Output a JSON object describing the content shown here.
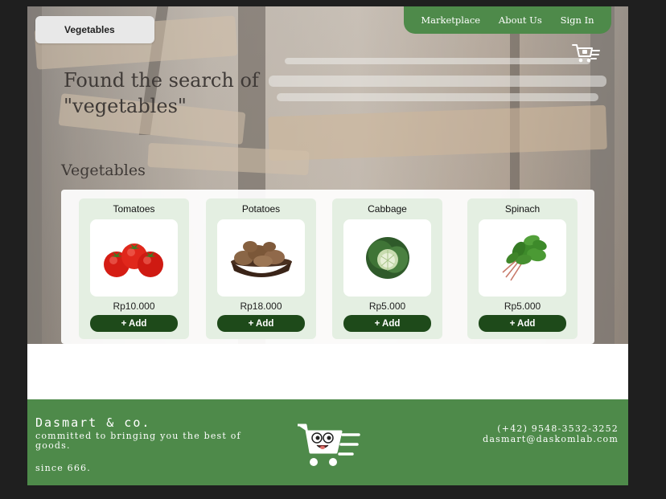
{
  "search": {
    "query": "Vegetables"
  },
  "nav": {
    "items": [
      "Marketplace",
      "About Us",
      "Sign In"
    ]
  },
  "hero": {
    "headline": "Found the search of \"vegetables\""
  },
  "section": {
    "title": "Vegetables"
  },
  "products": [
    {
      "name": "Tomatoes",
      "price": "Rp10.000",
      "add_label": "+ Add"
    },
    {
      "name": "Potatoes",
      "price": "Rp18.000",
      "add_label": "+ Add"
    },
    {
      "name": "Cabbage",
      "price": "Rp5.000",
      "add_label": "+ Add"
    },
    {
      "name": "Spinach",
      "price": "Rp5.000",
      "add_label": "+ Add"
    }
  ],
  "footer": {
    "brand": "Dasmart & co.",
    "tagline": "committed to bringing you the best of goods.",
    "since": "since 666.",
    "phone": "(+42) 9548-3532-3252",
    "email": "dasmart@daskomlab.com"
  },
  "colors": {
    "brand_green": "#4e8a4a",
    "button_dark_green": "#1e4a1a",
    "card_bg": "#e4efe2"
  },
  "icons": [
    "cart-icon",
    "cart-mascot-logo"
  ]
}
